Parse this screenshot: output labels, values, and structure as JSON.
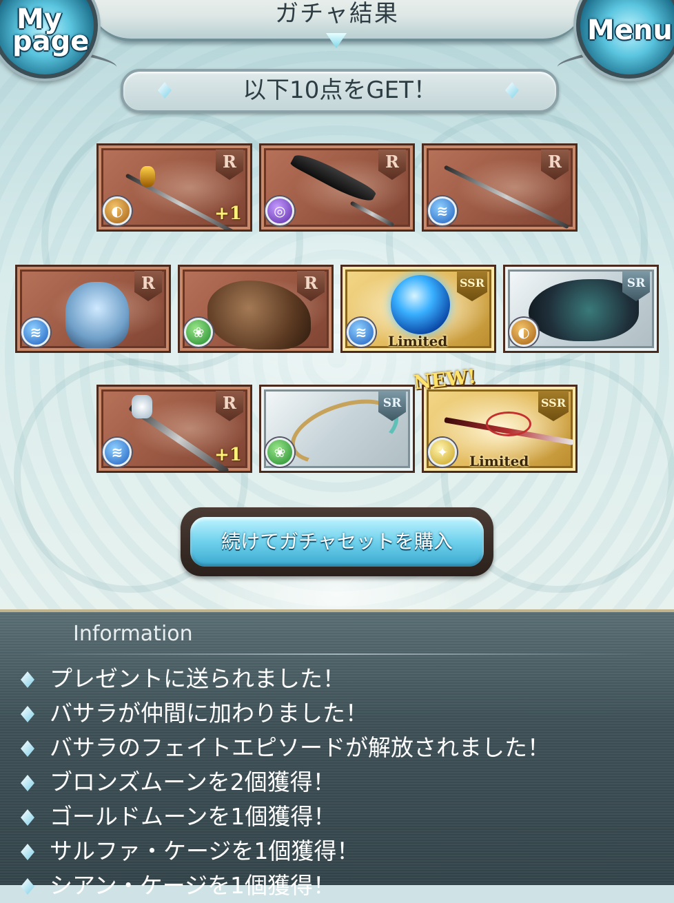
{
  "header": {
    "title": "ガチャ結果",
    "mypage_line1": "My",
    "mypage_line2": "page",
    "menu_label": "Menu"
  },
  "banner": {
    "text": "以下10点をGET！"
  },
  "items": [
    {
      "rarity": "R",
      "element": "earth",
      "element_icon": "earth-icon",
      "art": "polearm",
      "plus": "+1"
    },
    {
      "rarity": "R",
      "element": "dark",
      "element_icon": "dark-icon",
      "art": "scimitar"
    },
    {
      "rarity": "R",
      "element": "water",
      "element_icon": "water-icon",
      "art": "sword"
    },
    {
      "rarity": "R",
      "element": "water",
      "element_icon": "water-icon",
      "art": "skeleton-knight"
    },
    {
      "rarity": "R",
      "element": "wind",
      "element_icon": "wind-icon",
      "art": "beast"
    },
    {
      "rarity": "SSR",
      "element": "water",
      "element_icon": "water-icon",
      "art": "blue-orb",
      "limited": "Limited"
    },
    {
      "rarity": "SR",
      "element": "earth",
      "element_icon": "earth-icon",
      "art": "dragon"
    },
    {
      "rarity": "R",
      "element": "water",
      "element_icon": "water-icon",
      "art": "staff",
      "plus": "+1"
    },
    {
      "rarity": "SR",
      "element": "wind",
      "element_icon": "wind-icon",
      "art": "bow"
    },
    {
      "rarity": "SSR",
      "element": "light",
      "element_icon": "light-icon",
      "art": "katana",
      "limited": "Limited",
      "new": "NEW!"
    }
  ],
  "continue_button": {
    "label": "続けてガチャセットを購入"
  },
  "information": {
    "heading": "Information",
    "lines": [
      "プレゼントに送られました！",
      "バサラが仲間に加わりました！",
      "バサラのフェイトエピソードが解放されました！",
      "ブロンズムーンを2個獲得！",
      "ゴールドムーンを1個獲得！",
      "サルファ・ケージを1個獲得！",
      "シアン・ケージを1個獲得！"
    ]
  },
  "colors": {
    "accent_cyan": "#6fd1ec",
    "info_panel": "#3f5258",
    "r_card": "#9c5a44",
    "sr_card": "#c7d4d9",
    "ssr_card": "#e2b85a"
  }
}
